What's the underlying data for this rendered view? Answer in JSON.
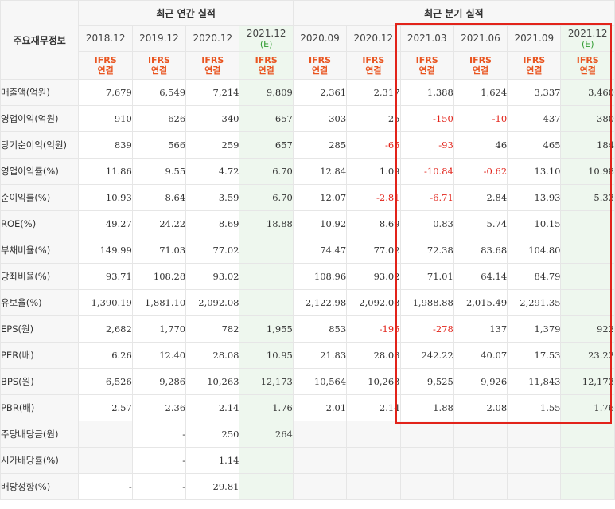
{
  "header": {
    "corner_label": "주요재무정보",
    "annual_group": "최근 연간 실적",
    "quarter_group": "최근 분기 실적",
    "periods": [
      {
        "top": "2018.12",
        "est": ""
      },
      {
        "top": "2019.12",
        "est": ""
      },
      {
        "top": "2020.12",
        "est": ""
      },
      {
        "top": "2021.12",
        "est": "(E)"
      },
      {
        "top": "2020.09",
        "est": ""
      },
      {
        "top": "2020.12",
        "est": ""
      },
      {
        "top": "2021.03",
        "est": ""
      },
      {
        "top": "2021.06",
        "est": ""
      },
      {
        "top": "2021.09",
        "est": ""
      },
      {
        "top": "2021.12",
        "est": "(E)"
      }
    ],
    "basis_line1": "IFRS",
    "basis_line2": "연결"
  },
  "rows": [
    {
      "label": "매출액(억원)",
      "values": [
        "7,679",
        "6,549",
        "7,214",
        "9,809",
        "2,361",
        "2,317",
        "1,388",
        "1,624",
        "3,337",
        "3,460"
      ]
    },
    {
      "label": "영업이익(억원)",
      "values": [
        "910",
        "626",
        "340",
        "657",
        "303",
        "25",
        "-150",
        "-10",
        "437",
        "380"
      ]
    },
    {
      "label": "당기순이익(억원)",
      "values": [
        "839",
        "566",
        "259",
        "657",
        "285",
        "-65",
        "-93",
        "46",
        "465",
        "184"
      ]
    },
    {
      "label": "영업이익률(%)",
      "values": [
        "11.86",
        "9.55",
        "4.72",
        "6.70",
        "12.84",
        "1.09",
        "-10.84",
        "-0.62",
        "13.10",
        "10.98"
      ]
    },
    {
      "label": "순이익률(%)",
      "values": [
        "10.93",
        "8.64",
        "3.59",
        "6.70",
        "12.07",
        "-2.81",
        "-6.71",
        "2.84",
        "13.93",
        "5.33"
      ]
    },
    {
      "label": "ROE(%)",
      "values": [
        "49.27",
        "24.22",
        "8.69",
        "18.88",
        "10.92",
        "8.69",
        "0.83",
        "5.74",
        "10.15",
        ""
      ]
    },
    {
      "label": "부채비율(%)",
      "values": [
        "149.99",
        "71.03",
        "77.02",
        "",
        "74.47",
        "77.02",
        "72.38",
        "83.68",
        "104.80",
        ""
      ]
    },
    {
      "label": "당좌비율(%)",
      "values": [
        "93.71",
        "108.28",
        "93.02",
        "",
        "108.96",
        "93.02",
        "71.01",
        "64.14",
        "84.79",
        ""
      ]
    },
    {
      "label": "유보율(%)",
      "values": [
        "1,390.19",
        "1,881.10",
        "2,092.08",
        "",
        "2,122.98",
        "2,092.08",
        "1,988.88",
        "2,015.49",
        "2,291.35",
        ""
      ]
    },
    {
      "label": "EPS(원)",
      "values": [
        "2,682",
        "1,770",
        "782",
        "1,955",
        "853",
        "-195",
        "-278",
        "137",
        "1,379",
        "922"
      ]
    },
    {
      "label": "PER(배)",
      "values": [
        "6.26",
        "12.40",
        "28.08",
        "10.95",
        "21.83",
        "28.08",
        "242.22",
        "40.07",
        "17.53",
        "23.22"
      ]
    },
    {
      "label": "BPS(원)",
      "values": [
        "6,526",
        "9,286",
        "10,263",
        "12,173",
        "10,564",
        "10,263",
        "9,525",
        "9,926",
        "11,843",
        "12,173"
      ]
    },
    {
      "label": "PBR(배)",
      "values": [
        "2.57",
        "2.36",
        "2.14",
        "1.76",
        "2.01",
        "2.14",
        "1.88",
        "2.08",
        "1.55",
        "1.76"
      ]
    },
    {
      "label": "주당배당금(원)",
      "values": [
        "",
        "-",
        "250",
        "264",
        "",
        "",
        "",
        "",
        "",
        ""
      ]
    },
    {
      "label": "시가배당률(%)",
      "values": [
        "",
        "-",
        "1.14",
        "",
        "",
        "",
        "",
        "",
        "",
        ""
      ]
    },
    {
      "label": "배당성향(%)",
      "values": [
        "-",
        "-",
        "29.81",
        "",
        "",
        "",
        "",
        "",
        "",
        ""
      ]
    }
  ],
  "colors": {
    "negative": "#e2231a",
    "estimate_bg": "#eef7ee",
    "estimate_text": "#2f9b2f",
    "ifrs_text": "#e9541f",
    "highlight_box": "#e2231a"
  }
}
